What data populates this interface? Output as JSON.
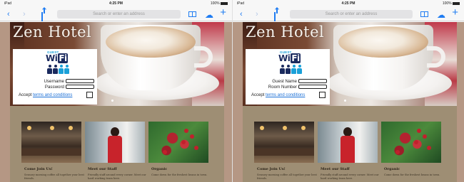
{
  "screens": [
    {
      "status": {
        "carrier": "iPad",
        "time": "4:25 PM",
        "battery": "100%"
      },
      "address_placeholder": "Search or enter an address",
      "hotel_title": "Zen Hotel",
      "wifi": {
        "guest": "GUEST",
        "word": "Wi",
        "fi": "Fi"
      },
      "form": {
        "field1_label": "Username",
        "field2_label": "Password",
        "accept_label": "Accept",
        "terms_link": "terms and conditions"
      },
      "cards": [
        {
          "title": "Come Join Us!",
          "desc": "Sensory morning coffee all together your best friends."
        },
        {
          "title": "Meet our Staff",
          "desc": "Friendly staff around every corner. Meet our hard working team here."
        },
        {
          "title": "Organic",
          "desc": "Come down for the freshest beans in town."
        }
      ]
    },
    {
      "status": {
        "carrier": "iPad",
        "time": "4:25 PM",
        "battery": "100%"
      },
      "address_placeholder": "Search or enter an address",
      "hotel_title": "Zen Hotel",
      "wifi": {
        "guest": "GUEST",
        "word": "Wi",
        "fi": "Fi"
      },
      "form": {
        "field1_label": "Guest Name",
        "field2_label": "Room Number",
        "accept_label": "Accept",
        "terms_link": "terms and conditions"
      },
      "cards": [
        {
          "title": "Come Join Us!",
          "desc": "Sensory morning coffee all together your best friends."
        },
        {
          "title": "Meet our Staff",
          "desc": "Friendly staff around every corner. Meet our hard working team here."
        },
        {
          "title": "Organic",
          "desc": "Come down for the freshest beans in town."
        }
      ]
    }
  ],
  "colors": {
    "accent": "#1f7cf2",
    "page_background": "#9e8e74",
    "wifi_navy": "#1a2a5e",
    "wifi_cyan": "#1aa0d8",
    "link": "#1a6fd6"
  }
}
